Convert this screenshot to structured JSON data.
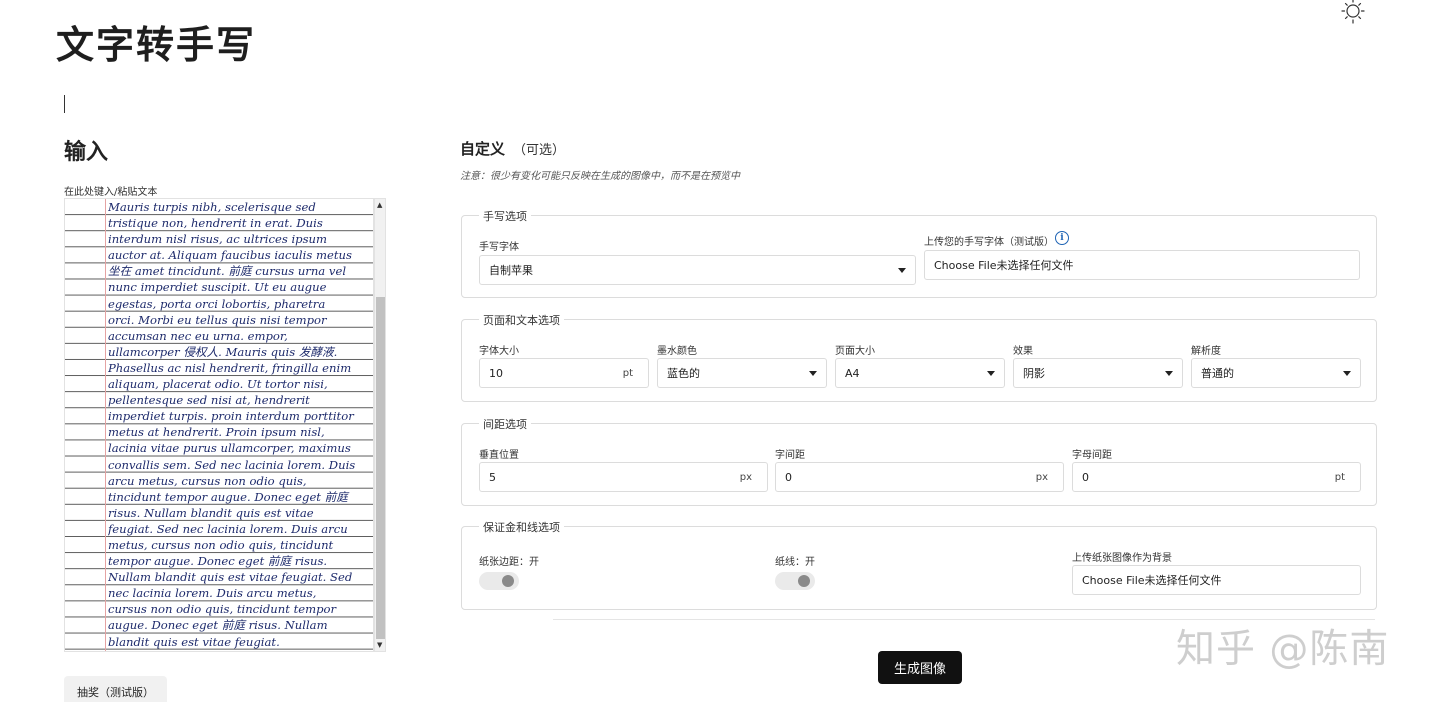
{
  "app": {
    "title": "文字转手写"
  },
  "input": {
    "heading": "输入",
    "label": "在此处键入/粘贴文本",
    "lines": [
      "Mauris turpis nibh, scelerisque sed",
      "tristique non, hendrerit in erat. Duis",
      "interdum nisl risus, ac ultrices ipsum",
      "auctor at. Aliquam faucibus iaculis metus",
      "坐在 amet tincidunt. 前庭 cursus urna vel",
      "nunc imperdiet suscipit. Ut eu augue",
      "egestas, porta orci lobortis, pharetra",
      "orci. Morbi eu tellus quis nisi tempor",
      "accumsan nec eu urna. empor,",
      "ullamcorper 侵权人. Mauris quis 发酵液.",
      "Phasellus ac nisl hendrerit, fringilla enim",
      "aliquam, placerat odio. Ut tortor nisi,",
      "pellentesque sed nisi at, hendrerit",
      "imperdiet turpis. proin interdum porttitor",
      "metus at hendrerit. Proin ipsum nisl,",
      "lacinia vitae purus ullamcorper, maximus",
      "convallis sem. Sed nec lacinia lorem. Duis",
      "arcu metus, cursus non odio quis,",
      "tincidunt tempor augue. Donec eget 前庭",
      "risus. Nullam blandit quis est vitae",
      "feugiat. Sed nec lacinia lorem. Duis arcu",
      "metus, cursus non odio quis, tincidunt",
      "tempor augue. Donec eget 前庭 risus.",
      "Nullam blandit quis est vitae feugiat. Sed",
      "nec lacinia lorem. Duis arcu metus,",
      "cursus non odio quis, tincidunt tempor",
      "augue. Donec eget 前庭 risus. Nullam",
      "blandit quis est vitae feugiat."
    ],
    "lottery_button": "抽奖（测试版）"
  },
  "custom": {
    "heading": "自定义",
    "optional": "（可选）",
    "note": "注意：很少有变化可能只反映在生成的图像中，而不是在预览中"
  },
  "handwriting": {
    "legend": "手写选项",
    "font_label": "手写字体",
    "font_value": "自制苹果",
    "upload_label": "上传您的手写字体（测试版）",
    "upload_value": "Choose File未选择任何文件"
  },
  "page_text": {
    "legend": "页面和文本选项",
    "font_size_label": "字体大小",
    "font_size_value": "10",
    "font_size_unit": "pt",
    "ink_color_label": "墨水颜色",
    "ink_color_value": "蓝色的",
    "page_size_label": "页面大小",
    "page_size_value": "A4",
    "effect_label": "效果",
    "effect_value": "阴影",
    "resolution_label": "解析度",
    "resolution_value": "普通的"
  },
  "spacing": {
    "legend": "间距选项",
    "vertical_label": "垂直位置",
    "vertical_value": "5",
    "vertical_unit": "px",
    "word_label": "字间距",
    "word_value": "0",
    "word_unit": "px",
    "letter_label": "字母间距",
    "letter_value": "0",
    "letter_unit": "pt"
  },
  "margins": {
    "legend": "保证金和线选项",
    "margin_label": "纸张边距：开",
    "lines_label": "纸线：开",
    "bg_label": "上传纸张图像作为背景",
    "bg_value": "Choose File未选择任何文件"
  },
  "generate_button": "生成图像",
  "watermark": "知乎 @陈南"
}
